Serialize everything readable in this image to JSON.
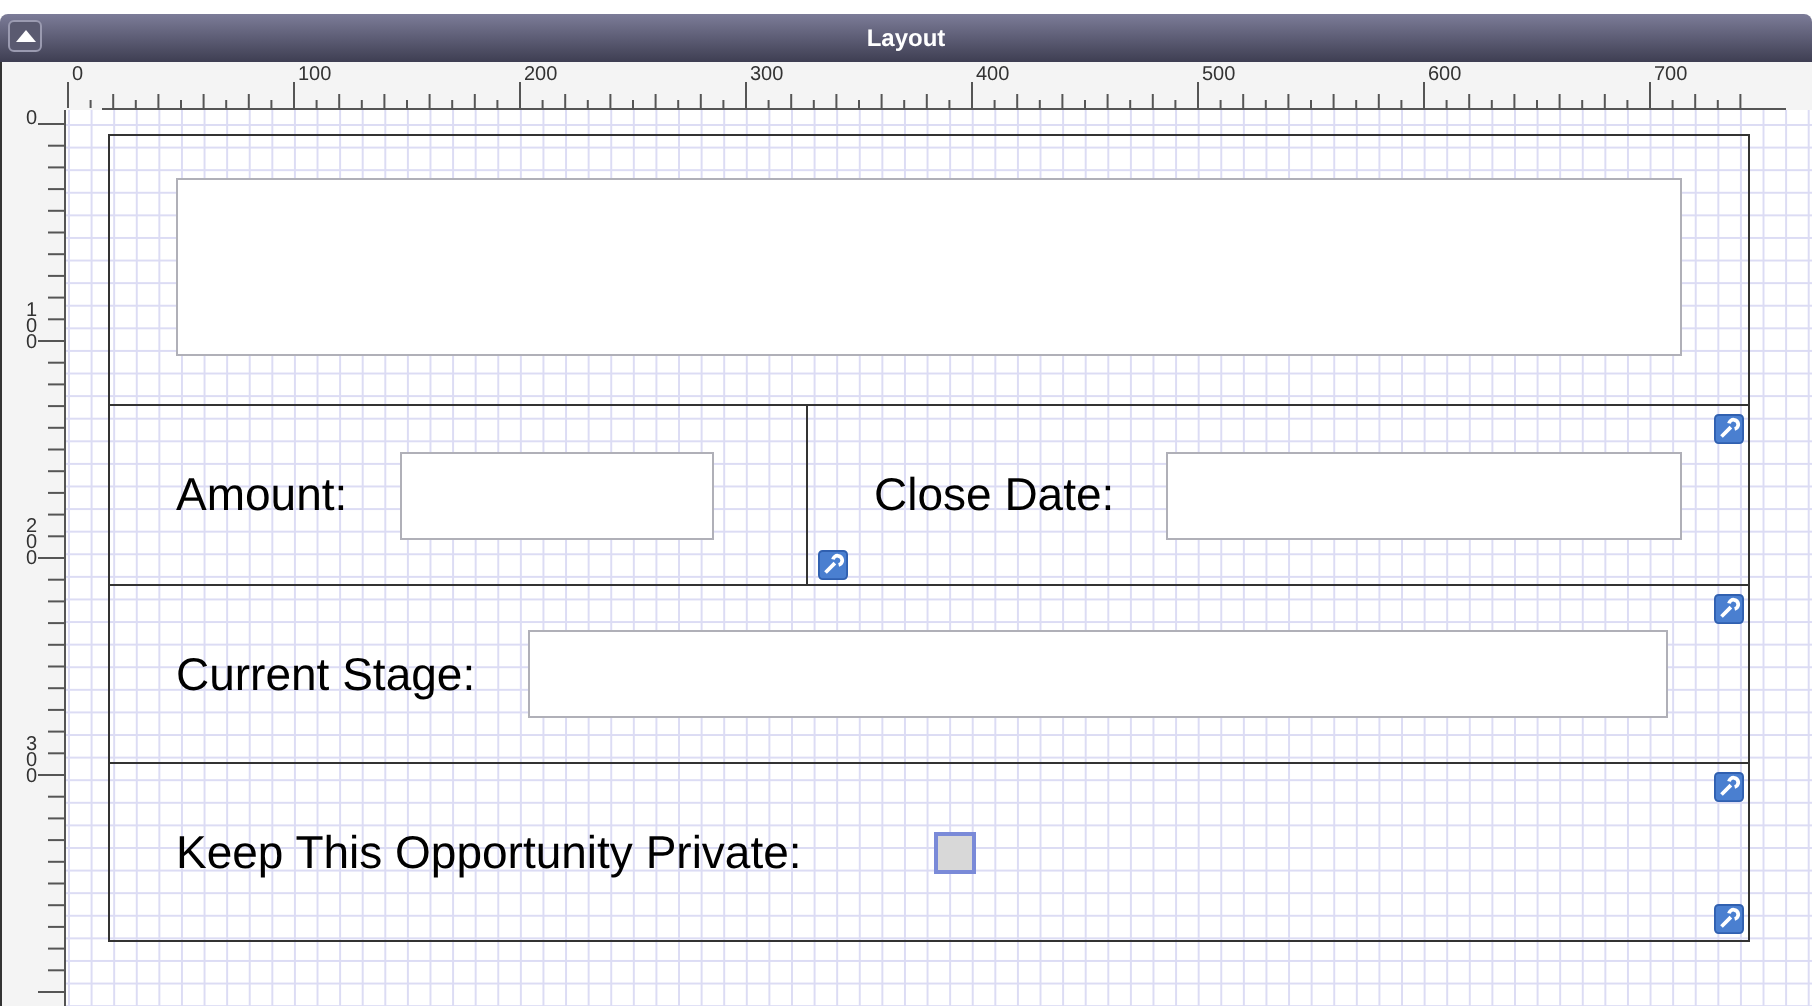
{
  "window": {
    "title": "Layout"
  },
  "rulers": {
    "horizontal": [
      "0",
      "100",
      "200",
      "300",
      "400",
      "500",
      "600",
      "700"
    ],
    "vertical": [
      "0",
      "100",
      "200",
      "300"
    ]
  },
  "sections": [
    {
      "kind": "blank"
    },
    {
      "kind": "pair",
      "fields": [
        {
          "label": "Amount:",
          "kind": "text"
        },
        {
          "label": "Close Date:",
          "kind": "text"
        }
      ]
    },
    {
      "kind": "single",
      "fields": [
        {
          "label": "Current Stage:",
          "kind": "text"
        }
      ]
    },
    {
      "kind": "single",
      "fields": [
        {
          "label": "Keep This Opportunity Private:",
          "kind": "checkbox",
          "checked": false
        }
      ]
    }
  ]
}
